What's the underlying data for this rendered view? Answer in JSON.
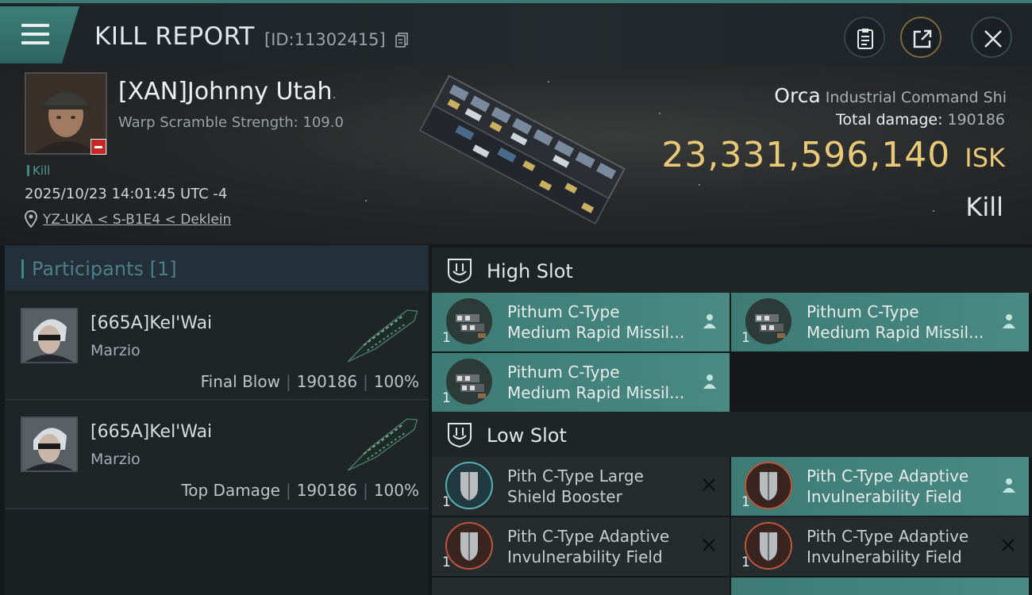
{
  "header": {
    "title": "KILL REPORT",
    "report_id": "[ID:11302415]"
  },
  "victim": {
    "name": "[XAN]Johnny Utah",
    "warp_scramble": "Warp Scramble Strength: 109.0",
    "tag": "Kill",
    "timestamp": "2025/10/23 14:01:45 UTC -4",
    "location": "YZ-UKA < S-B1E4 < Deklein"
  },
  "ship": {
    "name": "Orca",
    "class": "Industrial Command Shi",
    "total_damage_label": "Total damage:",
    "total_damage_value": "190186",
    "isk_value": "23,331,596,140",
    "isk_unit": "ISK",
    "status": "Kill"
  },
  "participants": {
    "title": "Participants [1]",
    "rows": [
      {
        "name": "[665A]Kel'Wai",
        "corp": "Marzio",
        "role": "Final Blow",
        "damage": "190186",
        "percent": "100%"
      },
      {
        "name": "[665A]Kel'Wai",
        "corp": "Marzio",
        "role": "Top Damage",
        "damage": "190186",
        "percent": "100%"
      }
    ]
  },
  "fitting": {
    "high_slot_label": "High Slot",
    "low_slot_label": "Low Slot",
    "high_modules": [
      {
        "qty": "1",
        "name_line1": "Pithum C-Type",
        "name_line2": "Medium Rapid Missil...",
        "status_icon": "person-icon"
      },
      {
        "qty": "1",
        "name_line1": "Pithum C-Type",
        "name_line2": "Medium Rapid Missil...",
        "status_icon": "person-icon"
      },
      {
        "qty": "1",
        "name_line1": "Pithum C-Type",
        "name_line2": "Medium Rapid Missil...",
        "status_icon": "person-icon"
      }
    ],
    "low_modules": [
      {
        "qty": "1",
        "name_line1": "Pith C-Type Large",
        "name_line2": "Shield Booster",
        "status_icon": "destroyed-x-icon"
      },
      {
        "qty": "1",
        "name_line1": "Pith C-Type Adaptive",
        "name_line2": "Invulnerability Field",
        "status_icon": "person-icon"
      },
      {
        "qty": "1",
        "name_line1": "Pith C-Type Adaptive",
        "name_line2": "Invulnerability Field",
        "status_icon": "destroyed-x-icon"
      },
      {
        "qty": "1",
        "name_line1": "Pith C-Type Adaptive",
        "name_line2": "Invulnerability Field",
        "status_icon": "destroyed-x-icon"
      }
    ]
  },
  "colors": {
    "accent_teal": "#3d7b74",
    "isk_gold": "#e8c977",
    "destroyed_red": "#c62828"
  }
}
